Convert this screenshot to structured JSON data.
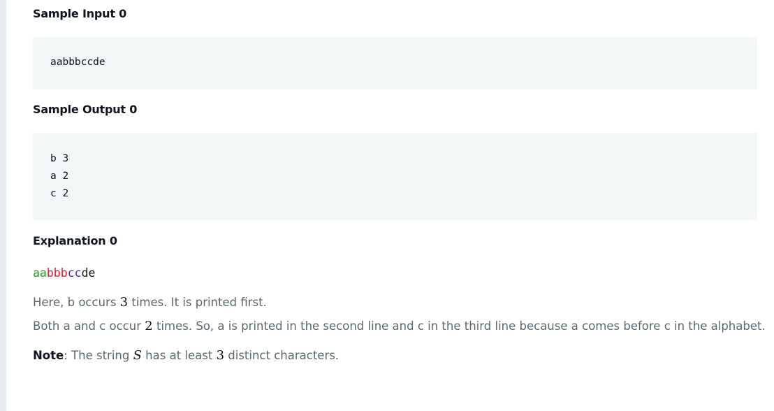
{
  "sample_input": {
    "heading": "Sample Input 0",
    "lines": [
      "aabbbccde"
    ]
  },
  "sample_output": {
    "heading": "Sample Output 0",
    "lines": [
      "b 3",
      "a 2",
      "c 2"
    ]
  },
  "explanation": {
    "heading": "Explanation 0",
    "colored_string": [
      {
        "text": "aa",
        "color": "#1a9c1a"
      },
      {
        "text": "bbb",
        "color": "#e0152b"
      },
      {
        "text": "cc",
        "color": "#3b2bd6"
      },
      {
        "text": "de",
        "color": "#0e141e"
      }
    ],
    "line1": {
      "before": "Here, b occurs ",
      "math": "3",
      "after": " times. It is printed first."
    },
    "line2": {
      "before": "Both a and c occur ",
      "math": "2",
      "after": " times. So, a is printed in the second line and c in the third line because a comes before c in the alphabet."
    },
    "note": {
      "label": "Note",
      "part1": ": The string ",
      "math1": "S",
      "part2": " has at least ",
      "math2": "3",
      "part3": " distinct characters."
    }
  }
}
